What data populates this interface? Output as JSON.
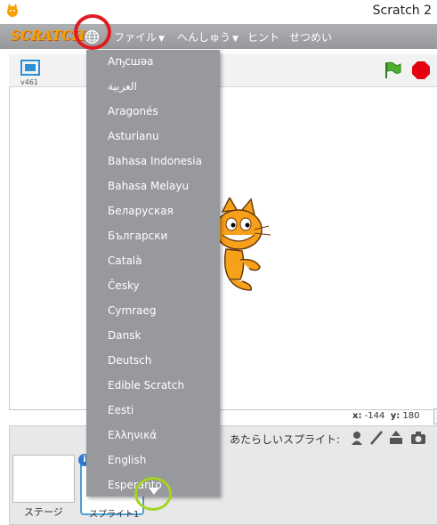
{
  "window": {
    "title": "Scratch 2"
  },
  "menubar": {
    "logo": "SCRATCH",
    "items": [
      {
        "label": "ファイル",
        "has_caret": true
      },
      {
        "label": "へんしゅう",
        "has_caret": true
      },
      {
        "label": "ヒント",
        "has_caret": false
      },
      {
        "label": "せつめい",
        "has_caret": false
      }
    ]
  },
  "stage": {
    "version": "v461"
  },
  "language_menu": {
    "items": [
      "Аҧсшәа",
      "العربية",
      "Aragonés",
      "Asturianu",
      "Bahasa Indonesia",
      "Bahasa Melayu",
      "Беларуская",
      "Български",
      "Català",
      "Česky",
      "Cymraeg",
      "Dansk",
      "Deutsch",
      "Edible Scratch",
      "Eesti",
      "Ελληνικά",
      "English",
      "Esperanto"
    ]
  },
  "coords": {
    "x_label": "x:",
    "x": "-144",
    "y_label": "y:",
    "y": "180"
  },
  "sprites": {
    "new_sprite_label": "あたらしいスプライト:",
    "stage_label": "ステージ",
    "sprite_label": "スプライト1",
    "info_badge": "i"
  },
  "colors": {
    "menubar": "#a0a1a4",
    "dropdown": "#98999c",
    "highlight_red": "#e11b22",
    "highlight_green": "#a4d420",
    "selected_sprite": "#4a9fd6"
  }
}
